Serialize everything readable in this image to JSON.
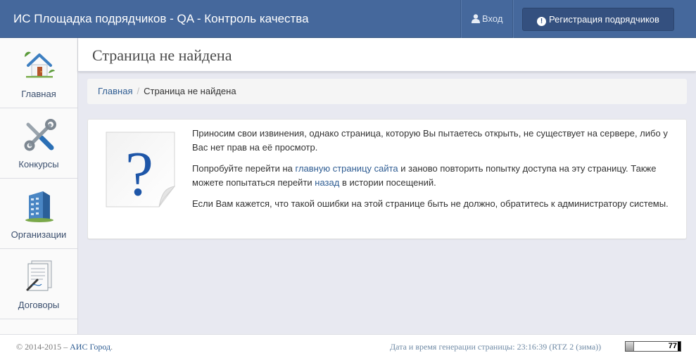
{
  "header": {
    "brand": "ИС Площадка подрядчиков - QA - Контроль качества",
    "login_label": "Вход",
    "register_label": "Регистрация подрядчиков",
    "info_glyph": "!"
  },
  "sidebar": {
    "items": [
      {
        "label": "Главная",
        "icon": "house-icon"
      },
      {
        "label": "Конкурсы",
        "icon": "tools-icon"
      },
      {
        "label": "Организации",
        "icon": "building-icon"
      },
      {
        "label": "Договоры",
        "icon": "contract-icon"
      }
    ]
  },
  "page": {
    "title": "Страница не найдена"
  },
  "breadcrumb": {
    "home": "Главная",
    "separator": "/",
    "current": "Страница не найдена"
  },
  "message": {
    "icon_glyph": "?",
    "p1": "Приносим свои извинения, однако страница, которую Вы пытаетесь открыть, не существует на сервере, либо у Вас нет прав на её просмотр.",
    "p2_before": "Попробуйте перейти на ",
    "p2_link": "главную страницу сайта",
    "p2_middle": " и заново повторить попытку доступа на эту страницу. Также можете попытаться перейти ",
    "p2_link2": "назад",
    "p2_after": " в истории посещений.",
    "p3": "Если Вам кажется, что такой ошибки на этой странице быть не должно, обратитесь к администратору системы."
  },
  "footer": {
    "copyright_prefix": "© 2014-2015 – ",
    "copyright_link": "АИС Город",
    "copyright_suffix": ".",
    "gen_time": "Дата и время генерации страницы: 23:16:39 (RTZ 2 (зима))",
    "counter_value": "77"
  },
  "colors": {
    "navbar": "#45689c",
    "register_button": "#34507f",
    "link": "#2f5d93",
    "background": "#e8e9f1"
  }
}
